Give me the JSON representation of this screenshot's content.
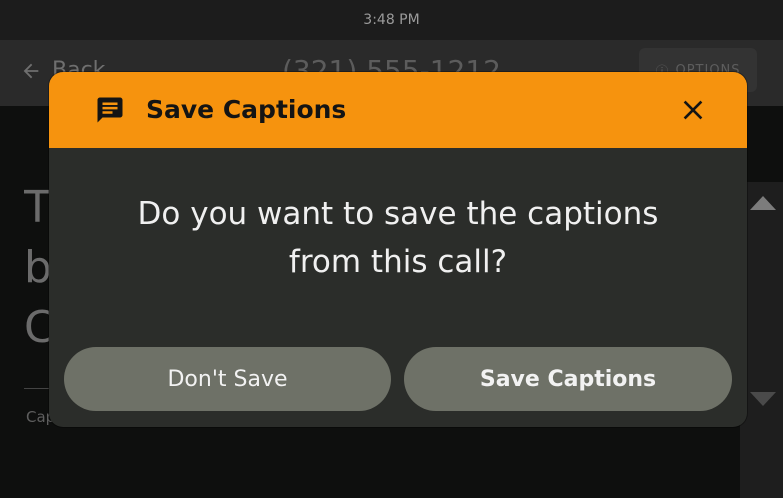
{
  "status_bar": {
    "time": "3:48 PM"
  },
  "header": {
    "back_label": "Back",
    "phone_number": "(321) 555-1212",
    "options_label": "OPTIONS"
  },
  "caption": {
    "lines": [
      "T",
      "b",
      "C"
    ],
    "footer": "Cap"
  },
  "dialog": {
    "title": "Save Captions",
    "message_line1": "Do you want to save the captions",
    "message_line2": "from this call?",
    "dont_save_label": "Don't Save",
    "save_label": "Save Captions"
  },
  "colors": {
    "accent": "#f6930e",
    "dialog_bg": "#2b2d2a",
    "button_bg": "#6e7167"
  },
  "icons": {
    "dialog_icon": "message-icon",
    "close_icon": "close-icon",
    "back_icon": "arrow-left-icon",
    "options_icon": "info-icon"
  }
}
